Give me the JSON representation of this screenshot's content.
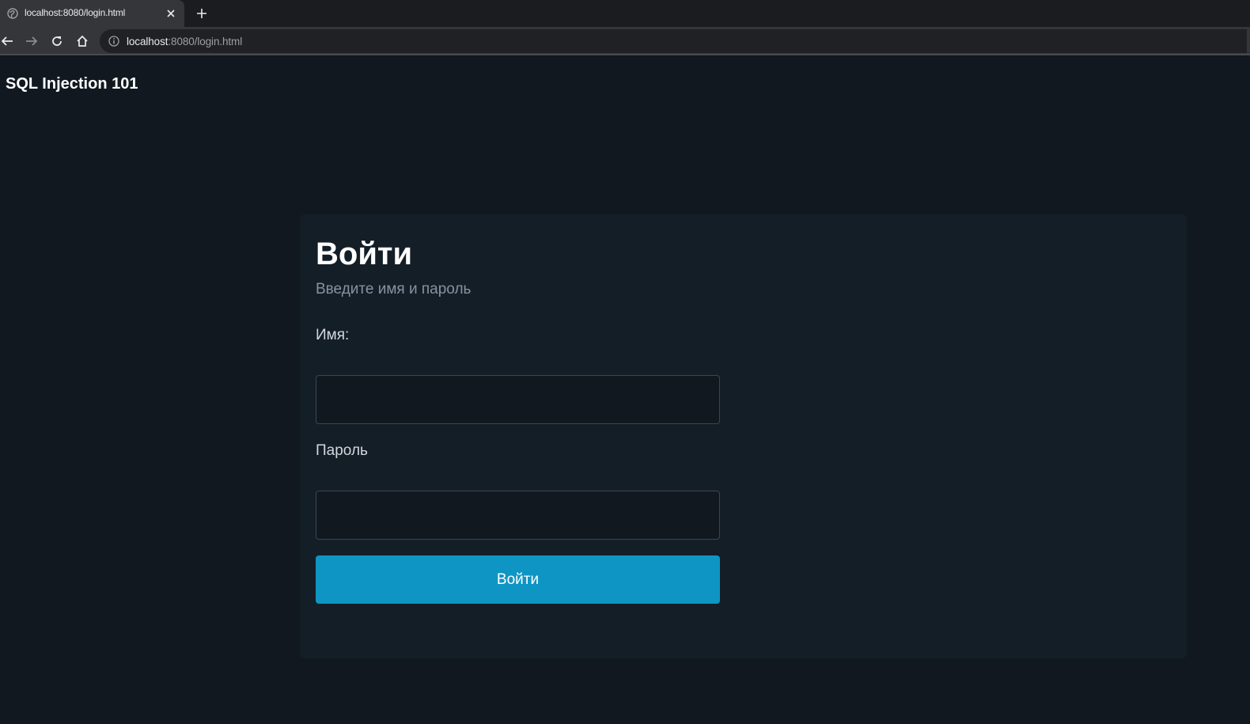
{
  "browser": {
    "tab_title": "localhost:8080/login.html",
    "url_host": "localhost",
    "url_rest": ":8080/login.html",
    "icons": [
      "globe-icon",
      "close-icon",
      "plus-icon",
      "back-arrow-icon",
      "forward-arrow-icon",
      "reload-icon",
      "home-icon",
      "info-icon"
    ]
  },
  "site": {
    "title": "SQL Injection 101"
  },
  "login": {
    "heading": "Войти",
    "subtitle": "Введите имя и пароль",
    "username_label": "Имя:",
    "username_value": "",
    "password_label": "Пароль",
    "password_value": "",
    "submit_label": "Войти"
  },
  "colors": {
    "page_background": "#111820",
    "card_background": "#141e27",
    "accent": "#0f95c4",
    "subtitle_text": "#8593a1"
  }
}
